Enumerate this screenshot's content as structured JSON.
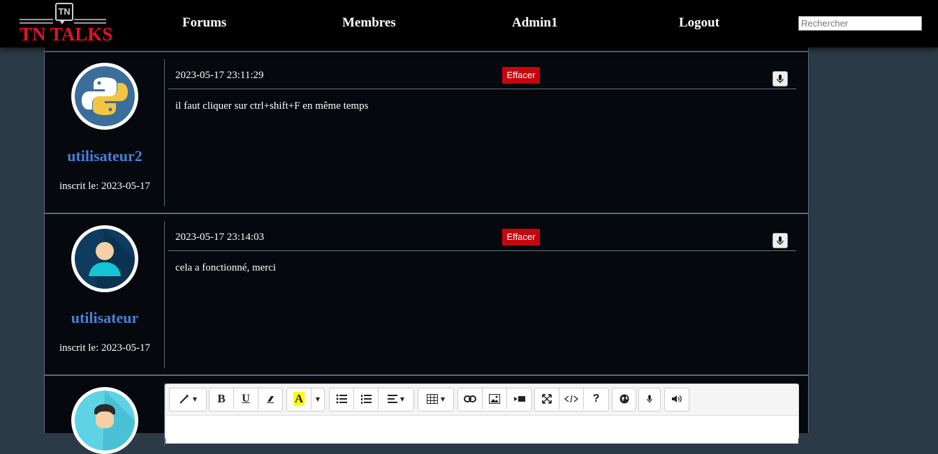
{
  "header": {
    "logo_badge": "TN",
    "logo_text": "TN TALKS",
    "nav": [
      "Forums",
      "Membres",
      "Admin1",
      "Logout"
    ],
    "search_placeholder": "Rechercher"
  },
  "posts": [
    {
      "username": "utilisateur2",
      "joined": "inscrit le: 2023-05-17",
      "date": "2023-05-17 23:11:29",
      "delete_label": "Effacer",
      "message": "il faut cliquer sur ctrl+shift+F en même temps",
      "avatar": "python-logo-avatar"
    },
    {
      "username": "utilisateur",
      "joined": "inscrit le: 2023-05-17",
      "date": "2023-05-17 23:14:03",
      "delete_label": "Effacer",
      "message": "cela a fonctionné, merci",
      "avatar": "person-avatar"
    }
  ],
  "editor": {
    "toolbar": {
      "bold": "B",
      "underline": "U",
      "help": "?"
    }
  },
  "colors": {
    "header_bg": "#000000",
    "page_bg": "#2b3a46",
    "post_bg": "#05080c",
    "username": "#4a80d4",
    "delete": "#c4070d",
    "logo_red": "#e3102b"
  }
}
